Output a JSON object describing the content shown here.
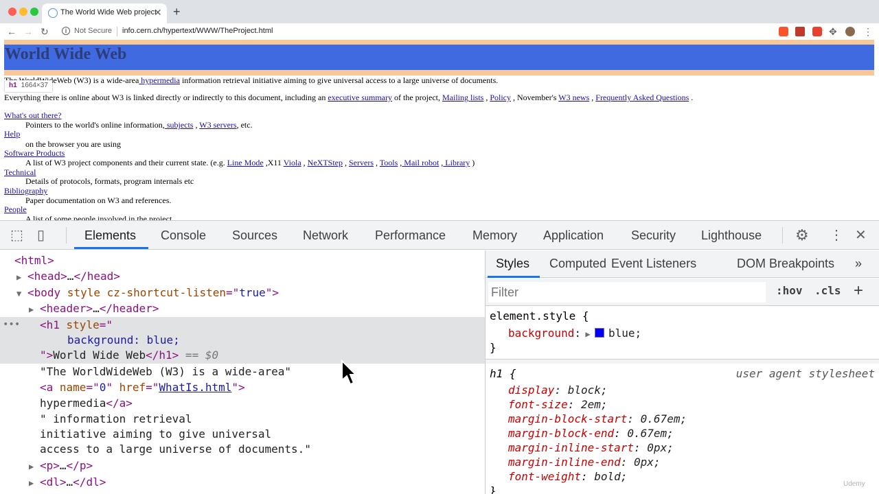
{
  "browser": {
    "tab_title": "The World Wide Web project",
    "tab_close": "✕",
    "new_tab": "+",
    "not_secure": "Not Secure",
    "url": "info.cern.ch/hypertext/WWW/TheProject.html",
    "colors": {
      "close": "#ff5f57",
      "minimize": "#febc2e",
      "maximize": "#28c840"
    }
  },
  "page": {
    "h1": "World Wide Web",
    "tooltip": {
      "tag": "h1",
      "size": "1664×37"
    },
    "intro": {
      "pre": "The WorldWideWeb (W3) is a wide-area",
      "link": " hypermedia",
      "post": " information retrieval initiative aiming to give universal access to a large universe of documents."
    },
    "p2": {
      "pre": "Everything there is online about W3 is linked directly or indirectly to this document, including an ",
      "link1": "executive summary",
      "mid1": " of the project, ",
      "link2": "Mailing lists",
      "mid2": " , ",
      "link3": "Policy",
      "mid3": " , November's ",
      "link4": "W3 news",
      "mid4": " , ",
      "link5": "Frequently Asked Questions",
      "post": " ."
    },
    "dl": {
      "whats_out": "What's out there?",
      "whats_out_desc_pre": "Pointers to the world's online information,",
      "subjects": " subjects",
      "sep1": " , ",
      "w3servers": "W3 servers",
      "whats_out_desc_post": ", etc.",
      "help": "Help",
      "help_desc": "on the browser you are using",
      "software": "Software Products",
      "software_desc_pre": "A list of W3 project components and their current state. (e.g. ",
      "line_mode": "Line Mode",
      "x11": " ,X11 ",
      "viola": "Viola",
      "comma1": " , ",
      "nextstep": "NeXTStep",
      "comma2": " , ",
      "servers": "Servers",
      "comma3": " , ",
      "tools": "Tools",
      "comma4": " ,",
      "mail_robot": " Mail robot",
      "comma5": " ,",
      "library": " Library",
      "close_paren": " )",
      "technical": "Technical",
      "technical_desc": "Details of protocols, formats, program internals etc",
      "bibliography": "Bibliography",
      "bibliography_desc": "Paper documentation on W3 and references.",
      "people": "People",
      "people_desc": "A list of some people involved in the project."
    }
  },
  "devtools": {
    "tabs": [
      "Elements",
      "Console",
      "Sources",
      "Network",
      "Performance",
      "Memory",
      "Application",
      "Security",
      "Lighthouse"
    ],
    "active_tab": "Elements",
    "close": "✕",
    "more": "⋮",
    "elements": {
      "html_open": "<html>",
      "head": {
        "open": "<head>",
        "ellipsis": "…",
        "close": "</head>"
      },
      "body": {
        "open": "<body",
        "attr": " style cz-shortcut-listen",
        "eq": "=\"",
        "val": "true",
        "end": "\">"
      },
      "header": {
        "open": "<header>",
        "ellipsis": "…",
        "close": "</header>"
      },
      "h1_open": "<h1",
      "h1_attr": " style",
      "h1_eq": "=\"",
      "h1_style": "background: blue;",
      "h1_end": "\">",
      "h1_text": "World Wide Web",
      "h1_close": "</h1>",
      "h1_dollar": " == $0",
      "text1": "\"The WorldWideWeb (W3) is a wide-area\"",
      "a_open": "<a",
      "a_name_attr": " name",
      "a_eq1": "=\"",
      "a_name_val": "0",
      "a_q1": "\"",
      "a_href_attr": " href",
      "a_eq2": "=\"",
      "a_href_val": "WhatIs.html",
      "a_end": "\">",
      "a_text": "hypermedia",
      "a_close": "</a>",
      "text2_1": "\" information retrieval",
      "text2_2": "initiative aiming to give universal",
      "text2_3": "access to a large universe of documents.\"",
      "p": {
        "open": "<p>",
        "ellipsis": "…",
        "close": "</p>"
      },
      "dl": {
        "open": "<dl>",
        "ellipsis": "…",
        "close": "</dl>"
      },
      "gutter": "•••"
    },
    "styles": {
      "tabs": [
        "Styles",
        "Computed",
        "Event Listeners",
        "DOM Breakpoints"
      ],
      "more": "»",
      "filter_placeholder": "Filter",
      "hov": ":hov",
      "cls": ".cls",
      "plus": "+",
      "element_style": {
        "selector": "element.style {",
        "prop": "background",
        "value": "blue;",
        "close": "}"
      },
      "h1_rule": {
        "selector": "h1 {",
        "source": "user agent stylesheet",
        "props": [
          {
            "name": "display",
            "value": "block;"
          },
          {
            "name": "font-size",
            "value": "2em;"
          },
          {
            "name": "margin-block-start",
            "value": "0.67em;"
          },
          {
            "name": "margin-block-end",
            "value": "0.67em;"
          },
          {
            "name": "margin-inline-start",
            "value": "0px;"
          },
          {
            "name": "margin-inline-end",
            "value": "0px;"
          },
          {
            "name": "font-weight",
            "value": "bold;"
          }
        ],
        "close": "}"
      }
    }
  },
  "watermark": "Udemy"
}
